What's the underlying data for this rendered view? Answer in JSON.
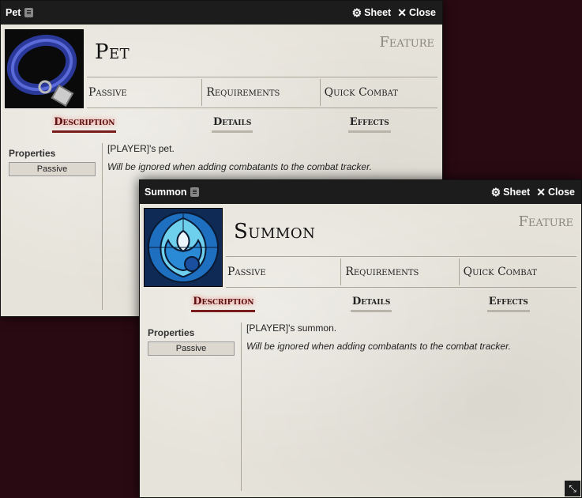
{
  "windows": {
    "pet": {
      "title": "Pet",
      "sheet_label": "Sheet",
      "close_label": "Close",
      "name": "Pet",
      "type": "Feature",
      "summary": [
        "Passive",
        "Requirements",
        "Quick Combat"
      ],
      "tabs": [
        "Description",
        "Details",
        "Effects"
      ],
      "active_tab": "Description",
      "properties_label": "Properties",
      "property_tag": "Passive",
      "description": "[PLAYER]'s pet.",
      "note": "Will be ignored when adding combatants to the combat tracker.",
      "icon": "collar-icon"
    },
    "summon": {
      "title": "Summon",
      "sheet_label": "Sheet",
      "close_label": "Close",
      "name": "Summon",
      "type": "Feature",
      "summary": [
        "Passive",
        "Requirements",
        "Quick Combat"
      ],
      "tabs": [
        "Description",
        "Details",
        "Effects"
      ],
      "active_tab": "Description",
      "properties_label": "Properties",
      "property_tag": "Passive",
      "description": "[PLAYER]'s summon.",
      "note": "Will be ignored when adding combatants to the combat tracker.",
      "icon": "stained-glass-summon-icon"
    }
  },
  "colors": {
    "background": "#2a0a12",
    "titlebar": "#1c1c1c",
    "parchment": "#e6e3da",
    "active_tab": "#7a1c1c"
  }
}
